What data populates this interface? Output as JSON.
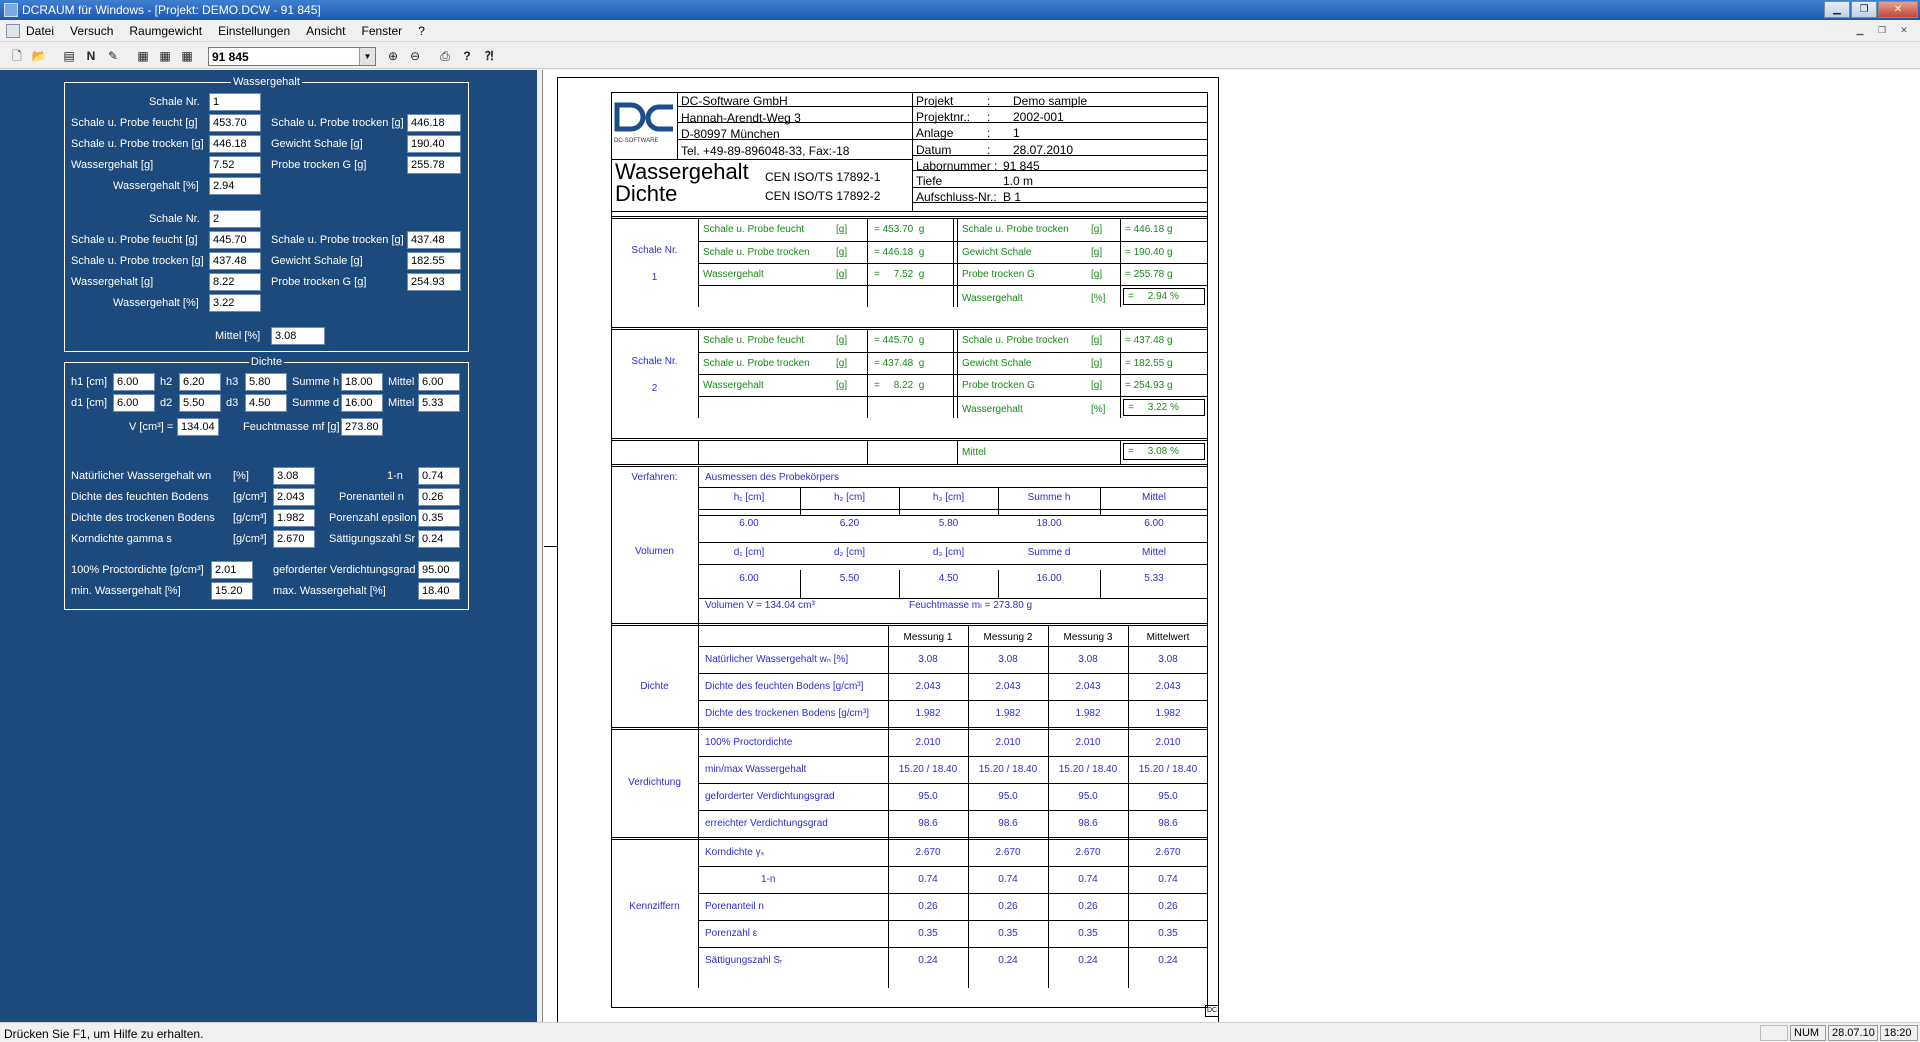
{
  "title": "DCRAUM für Windows - [Projekt: DEMO.DCW - 91 845]",
  "menu": [
    "Datei",
    "Versuch",
    "Raumgewicht",
    "Einstellungen",
    "Ansicht",
    "Fenster",
    "?"
  ],
  "toolbar": {
    "combo_value": "91 845"
  },
  "form": {
    "wg_title": "Wassergehalt",
    "schale_nr_label": "Schale Nr.",
    "schale1": {
      "nr": "1",
      "feucht": "453.70",
      "trocken": "446.18",
      "wassergehalt_g": "7.52",
      "wassergehalt_pct": "2.94",
      "trocken_r": "446.18",
      "gewicht": "190.40",
      "probe_g": "255.78"
    },
    "schale2": {
      "nr": "2",
      "feucht": "445.70",
      "trocken": "437.48",
      "wassergehalt_g": "8.22",
      "wassergehalt_pct": "3.22",
      "trocken_r": "437.48",
      "gewicht": "182.55",
      "probe_g": "254.93"
    },
    "lbl_feucht": "Schale u. Probe feucht [g]",
    "lbl_trocken": "Schale u. Probe trocken [g]",
    "lbl_wg_g": "Wassergehalt [g]",
    "lbl_wg_pct": "Wassergehalt [%]",
    "lbl_gewicht": "Gewicht Schale [g]",
    "lbl_probe_g": "Probe trocken G [g]",
    "mittel_label": "Mittel [%]",
    "mittel": "3.08",
    "dichte_title": "Dichte",
    "dichte": {
      "h1_l": "h1 [cm]",
      "h1": "6.00",
      "h2_l": "h2",
      "h2": "6.20",
      "h3_l": "h3",
      "h3": "5.80",
      "sumh_l": "Summe h",
      "sumh": "18.00",
      "mittel_l": "Mittel",
      "mittel_h": "6.00",
      "d1_l": "d1 [cm]",
      "d1": "6.00",
      "d2_l": "d2",
      "d2": "5.50",
      "d3_l": "d3",
      "d3": "4.50",
      "sumd_l": "Summe d",
      "sumd": "16.00",
      "mittel_d": "5.33",
      "v_l": "V [cm³] =",
      "v": "134.04",
      "fm_l": "Feuchtmasse mf [g]",
      "fm": "273.80",
      "wn_l": "Natürlicher Wassergehalt wn",
      "wn_u": "[%]",
      "wn": "3.08",
      "n1_l": "1-n",
      "n1": "0.74",
      "rf_l": "Dichte des feuchten Bodens",
      "rf_u": "[g/cm³]",
      "rf": "2.043",
      "pn_l": "Porenanteil n",
      "pn": "0.26",
      "rt_l": "Dichte des trockenen Bodens",
      "rt_u": "[g/cm³]",
      "rt": "1.982",
      "pe_l": "Porenzahl epsilon",
      "pe": "0.35",
      "ks_l": "Korndichte gamma s",
      "ks_u": "[g/cm³]",
      "ks": "2.670",
      "sr_l": "Sättigungszahl Sr",
      "sr": "0.24",
      "pd_l": "100% Proctordichte [g/cm³]",
      "pd": "2.01",
      "gv_l": "geforderter Verdichtungsgrad",
      "gv": "95.00",
      "minw_l": "min. Wassergehalt [%]",
      "minw": "15.20",
      "maxw_l": "max. Wassergehalt [%]",
      "maxw": "18.40"
    }
  },
  "report": {
    "logo_sub": "DC-SOFTWARE",
    "company": [
      "DC-Software GmbH",
      "Hannah-Arendt-Weg 3",
      "D-80997 München",
      "Tel. +49-89-896048-33, Fax:-18"
    ],
    "meta_labels": [
      "Projekt",
      "Projektnr.:",
      "Anlage",
      "Datum",
      "Labornummer :",
      "Tiefe",
      "Aufschluss-Nr.:"
    ],
    "meta_colons": [
      ":",
      ":",
      ":",
      ":"
    ],
    "meta_values": [
      "Demo sample",
      "2002-001",
      "1",
      "28.07.2010",
      "91 845",
      "1.0 m",
      "B 1"
    ],
    "title1": "Wassergehalt",
    "title2": "Dichte",
    "norm1": "CEN ISO/TS 17892-1",
    "norm2": "CEN ISO/TS 17892-2",
    "schale_nr": "Schale Nr.",
    "sec1": {
      "nr": "1",
      "feucht": "= 453.70  g",
      "trocken": "= 446.18  g",
      "wg": "=     7.52  g",
      "trocken_r": "= 446.18 g",
      "gewicht": "= 190.40 g",
      "probe": "= 255.78 g",
      "pct": "=     2.94 %"
    },
    "sec2": {
      "nr": "2",
      "feucht": "= 445.70  g",
      "trocken": "= 437.48  g",
      "wg": "=     8.22  g",
      "trocken_r": "= 437.48 g",
      "gewicht": "= 182.55 g",
      "probe": "= 254.93 g",
      "pct": "=     3.22 %"
    },
    "l_feucht": "Schale u. Probe feucht",
    "l_trocken": "Schale u. Probe trocken",
    "l_wg": "Wassergehalt",
    "l_gewicht": "Gewicht Schale",
    "l_probe": "Probe trocken G",
    "u_g": "[g]",
    "u_pct": "[%]",
    "mittel_l": "Mittel",
    "mittel": "=     3.08 %",
    "verfahren_l": "Verfahren:",
    "verfahren": "Ausmessen des Probekörpers",
    "volumen_l": "Volumen",
    "vol_head1": [
      "h₁ [cm]",
      "h₂ [cm]",
      "h₃ [cm]",
      "Summe h",
      "Mittel"
    ],
    "vol_row1": [
      "6.00",
      "6.20",
      "5.80",
      "18.00",
      "6.00"
    ],
    "vol_head2": [
      "d₁ [cm]",
      "d₂ [cm]",
      "d₃ [cm]",
      "Summe d",
      "Mittel"
    ],
    "vol_row2": [
      "6.00",
      "5.50",
      "4.50",
      "16.00",
      "5.33"
    ],
    "volumen_text": "Volumen V = 134.04 cm³",
    "feucht_text": "Feuchtmasse mₗ = 273.80 g",
    "mess_head": [
      "Messung 1",
      "Messung 2",
      "Messung 3",
      "Mittelwert"
    ],
    "dichte_l": "Dichte",
    "dichte_rows": [
      {
        "label": "Natürlicher Wassergehalt wₙ [%]",
        "v": [
          "3.08",
          "3.08",
          "3.08",
          "3.08"
        ]
      },
      {
        "label": "Dichte des feuchten Bodens  [g/cm³]",
        "v": [
          "2.043",
          "2.043",
          "2.043",
          "2.043"
        ]
      },
      {
        "label": "Dichte des trockenen Bodens  [g/cm³]",
        "v": [
          "1.982",
          "1.982",
          "1.982",
          "1.982"
        ]
      }
    ],
    "verd_l": "Verdichtung",
    "verd_rows": [
      {
        "label": "100% Proctordichte",
        "v": [
          "2.010",
          "2.010",
          "2.010",
          "2.010"
        ]
      },
      {
        "label": "min/max Wassergehalt",
        "v": [
          "15.20 / 18.40",
          "15.20 / 18.40",
          "15.20 / 18.40",
          "15.20 / 18.40"
        ]
      },
      {
        "label": "geforderter Verdichtungsgrad",
        "v": [
          "95.0",
          "95.0",
          "95.0",
          "95.0"
        ]
      },
      {
        "label": "erreichter Verdichtungsgrad",
        "v": [
          "98.6",
          "98.6",
          "98.6",
          "98.6"
        ]
      }
    ],
    "kenn_l": "Kennziffern",
    "kenn_rows": [
      {
        "label": "Korndichte γₛ",
        "v": [
          "2.670",
          "2.670",
          "2.670",
          "2.670"
        ]
      },
      {
        "label": "1-n",
        "v": [
          "0.74",
          "0.74",
          "0.74",
          "0.74"
        ]
      },
      {
        "label": "Porenanteil n",
        "v": [
          "0.26",
          "0.26",
          "0.26",
          "0.26"
        ]
      },
      {
        "label": "Porenzahl ε",
        "v": [
          "0.35",
          "0.35",
          "0.35",
          "0.35"
        ]
      },
      {
        "label": "Sättigungszahl Sᵣ",
        "v": [
          "0.24",
          "0.24",
          "0.24",
          "0.24"
        ]
      }
    ],
    "corner": "DC"
  },
  "status": {
    "msg": "Drücken Sie F1, um Hilfe zu erhalten.",
    "num": "NUM",
    "date": "28.07.10",
    "time": "18:20"
  }
}
